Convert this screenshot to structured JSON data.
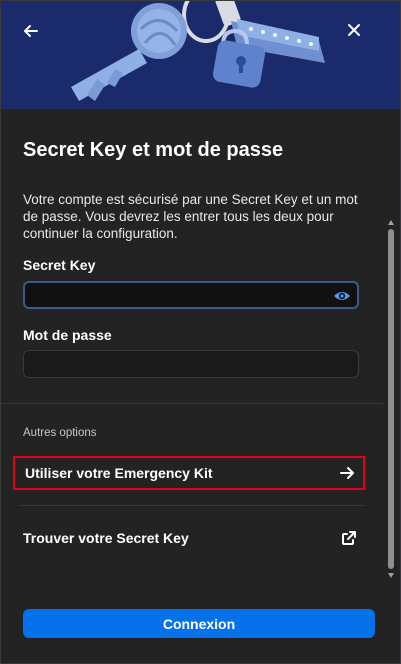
{
  "header": {
    "back_icon": "arrow-left-icon",
    "close_icon": "close-icon",
    "illustration": "keys-illustration",
    "background_color": "#1a2a6b"
  },
  "main": {
    "title": "Secret Key et mot de passe",
    "description": "Votre compte est sécurisé par une Secret Key et un mot de passe. Vous devrez les entrer tous les deux pour continuer la configuration.",
    "secret_key": {
      "label": "Secret Key",
      "value": "",
      "placeholder": ""
    },
    "password": {
      "label": "Mot de passe",
      "value": "",
      "placeholder": ""
    }
  },
  "options": {
    "section_label": "Autres options",
    "items": [
      {
        "label": "Utiliser votre Emergency Kit",
        "icon": "arrow-right-icon"
      },
      {
        "label": "Trouver votre Secret Key",
        "icon": "external-link-icon"
      }
    ]
  },
  "footer": {
    "connect_label": "Connexion",
    "accent": "#0572ec"
  },
  "colors": {
    "highlight_border": "#e3001b",
    "focus_border": "#3b5a8c"
  }
}
